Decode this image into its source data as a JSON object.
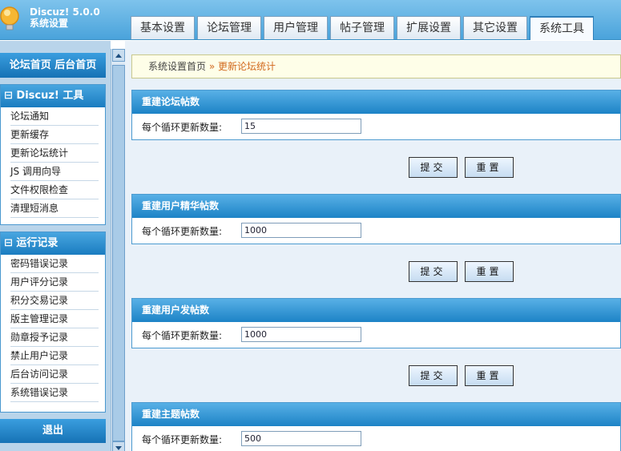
{
  "header": {
    "brand_line1": "Discuz! 5.0.0",
    "brand_line2": "系统设置",
    "tabs": [
      "基本设置",
      "论坛管理",
      "用户管理",
      "帖子管理",
      "扩展设置",
      "其它设置",
      "系统工具"
    ]
  },
  "sidebar": {
    "top_nav": "论坛首页  后台首页",
    "tools_title": "⊟ Discuz! 工具",
    "tools_items": [
      "论坛通知",
      "更新缓存",
      "更新论坛统计",
      "JS 调用向导",
      "文件权限检查",
      "清理短消息"
    ],
    "logs_title": "⊟ 运行记录",
    "logs_items": [
      "密码错误记录",
      "用户评分记录",
      "积分交易记录",
      "版主管理记录",
      "勋章授予记录",
      "禁止用户记录",
      "后台访问记录",
      "系统错误记录"
    ],
    "logout": "退出"
  },
  "breadcrumb": {
    "home": "系统设置首页",
    "sep": " » ",
    "current": "更新论坛统计"
  },
  "sections": [
    {
      "title": "重建论坛帖数",
      "label": "每个循环更新数量:",
      "value": "15"
    },
    {
      "title": "重建用户精华帖数",
      "label": "每个循环更新数量:",
      "value": "1000"
    },
    {
      "title": "重建用户发帖数",
      "label": "每个循环更新数量:",
      "value": "1000"
    },
    {
      "title": "重建主题帖数",
      "label": "每个循环更新数量:",
      "value": "500"
    }
  ],
  "buttons": {
    "submit": "提交",
    "reset": "重置"
  },
  "colors": {
    "accent": "#1d83c6",
    "header_bg": "#5aaee2",
    "sidebar_bg": "#b9d4ea",
    "breadcrumb_bg": "#fefee8",
    "breadcrumb_current": "#d2691e"
  }
}
